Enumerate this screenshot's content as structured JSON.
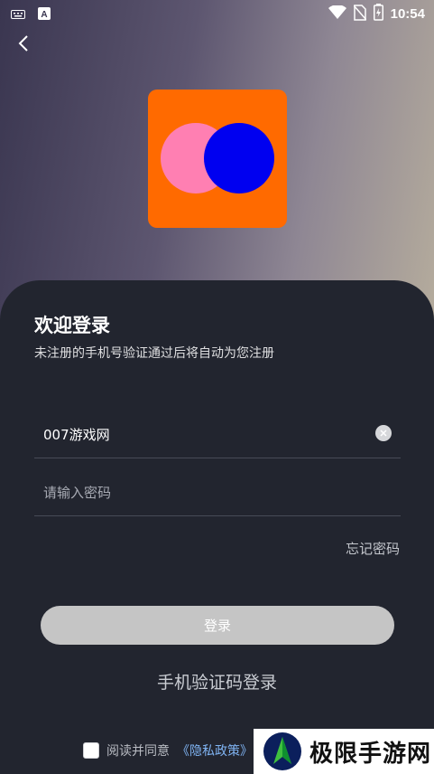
{
  "status_bar": {
    "time": "10:54",
    "left_icons": [
      "keyboard-icon",
      "a-box-icon"
    ],
    "right_icons": [
      "wifi-icon",
      "no-sim-icon",
      "battery-charging-icon"
    ]
  },
  "nav": {
    "back_icon": "chevron-left-icon"
  },
  "logo": {
    "bg_color": "#ff6a00",
    "circle_left_color": "#ff7fb2",
    "circle_right_color": "#0000f0"
  },
  "login_panel": {
    "title": "欢迎登录",
    "subtitle": "未注册的手机号验证通过后将自动为您注册",
    "username_value": "007游戏网",
    "password_placeholder": "请输入密码",
    "forgot_password": "忘记密码",
    "login_button": "登录",
    "sms_login": "手机验证码登录"
  },
  "agreement": {
    "prefix": "阅读并同意",
    "policy_link": "《隐私政策》",
    "checked": false
  },
  "watermark": {
    "text": "极限手游网"
  },
  "colors": {
    "panel": "#22252f",
    "link": "#7fb3f2",
    "button": "#c5c5c5"
  }
}
